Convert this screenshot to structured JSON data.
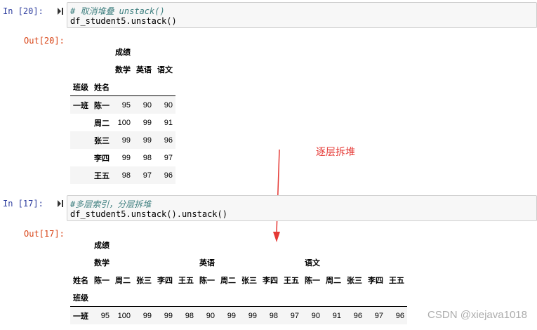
{
  "cell1": {
    "in_prompt": "In  [20]:",
    "comment": "# 取消堆叠 unstack()",
    "code": "df_student5.unstack()",
    "out_prompt": "Out[20]:",
    "top_header": "成绩",
    "columns": [
      "数学",
      "英语",
      "语文"
    ],
    "index_names": [
      "班级",
      "姓名"
    ],
    "rows": [
      {
        "class": "一班",
        "name": "陈一",
        "values": [
          "95",
          "90",
          "90"
        ]
      },
      {
        "class": "",
        "name": "周二",
        "values": [
          "100",
          "99",
          "91"
        ]
      },
      {
        "class": "",
        "name": "张三",
        "values": [
          "99",
          "99",
          "96"
        ]
      },
      {
        "class": "",
        "name": "李四",
        "values": [
          "99",
          "98",
          "97"
        ]
      },
      {
        "class": "",
        "name": "王五",
        "values": [
          "98",
          "97",
          "96"
        ]
      }
    ]
  },
  "annotation": "逐层拆堆",
  "cell2": {
    "in_prompt": "In  [17]:",
    "comment": "#多层索引，分层拆堆",
    "code": "df_student5.unstack().unstack()",
    "out_prompt": "Out[17]:",
    "top_header": "成绩",
    "subjects": [
      "数学",
      "英语",
      "语文"
    ],
    "name_label": "姓名",
    "names": [
      "陈一",
      "周二",
      "张三",
      "李四",
      "王五"
    ],
    "index_label": "班级",
    "row_label": "一班",
    "values": [
      "95",
      "100",
      "99",
      "99",
      "98",
      "90",
      "99",
      "99",
      "98",
      "97",
      "90",
      "91",
      "96",
      "97",
      "96"
    ]
  },
  "watermark": "CSDN @xiejava1018",
  "colors": {
    "in_prompt": "#303f9f",
    "out_prompt": "#d84315",
    "annotation": "#e53935",
    "arrow": "#e53935"
  }
}
